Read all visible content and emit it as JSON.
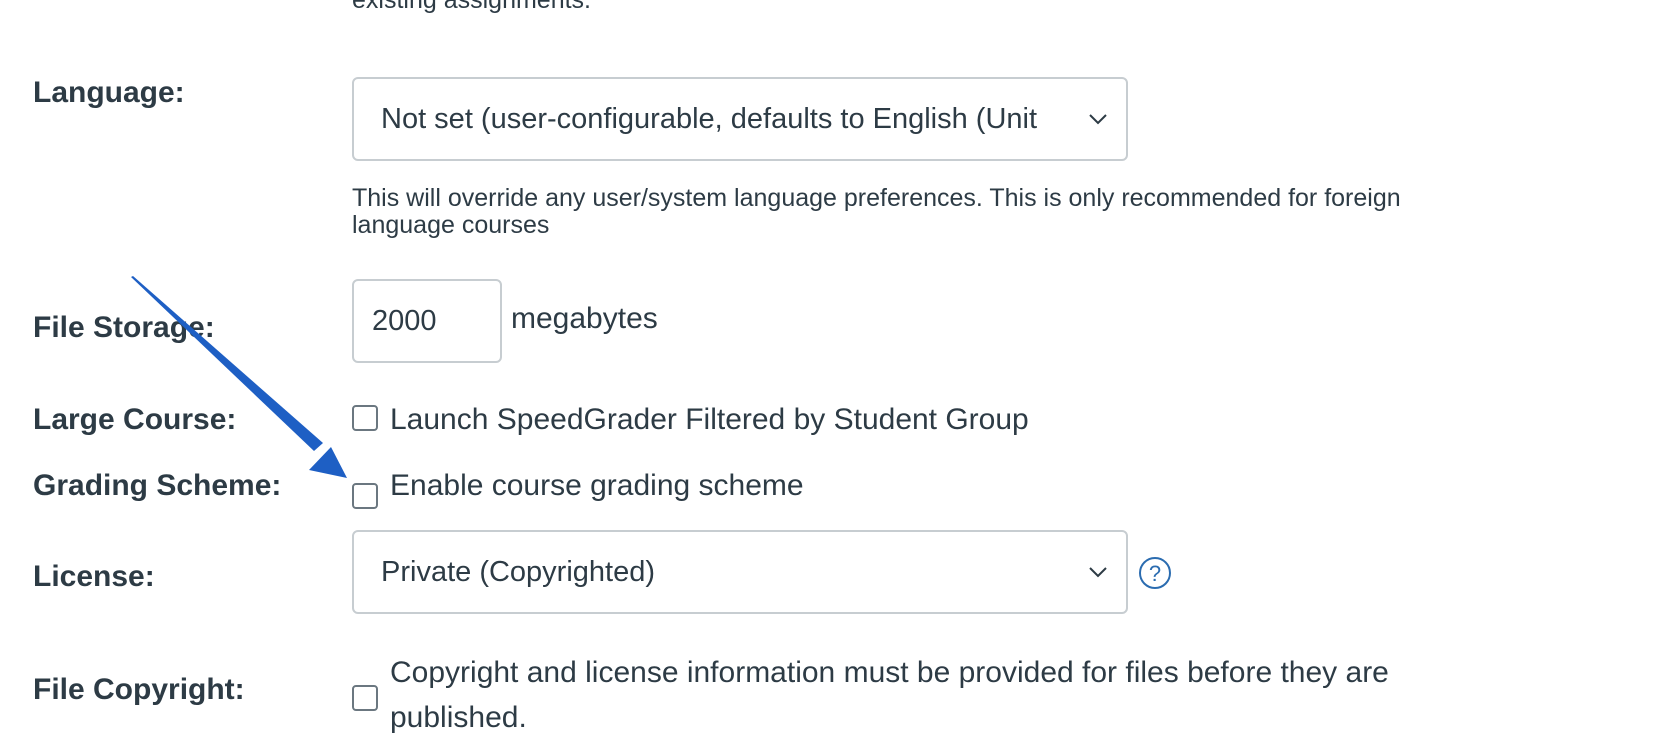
{
  "top_fragment": "existing assignments.",
  "language": {
    "label": "Language:",
    "selected": "Not set (user-configurable, defaults to English (Unit",
    "help_line1": "This will override any user/system language preferences. This is only recommended for foreign",
    "help_line2": "language courses"
  },
  "file_storage": {
    "label": "File Storage:",
    "value": "2000",
    "unit": "megabytes"
  },
  "large_course": {
    "label": "Large Course:",
    "option": "Launch SpeedGrader Filtered by Student Group",
    "checked": false
  },
  "grading_scheme": {
    "label": "Grading Scheme:",
    "option": "Enable course grading scheme",
    "checked": false
  },
  "license": {
    "label": "License:",
    "selected": "Private (Copyrighted)",
    "help_icon": "question-circle-icon"
  },
  "file_copyright": {
    "label": "File Copyright:",
    "option_line1": "Copyright and license information must be provided for files before they are",
    "option_line2": "published.",
    "checked": false
  },
  "annotation": {
    "icon": "arrow-annotation",
    "color": "#1e5fc4"
  },
  "colors": {
    "text": "#2d3b45",
    "border": "#c7cdd1",
    "link": "#2b6cb0"
  }
}
